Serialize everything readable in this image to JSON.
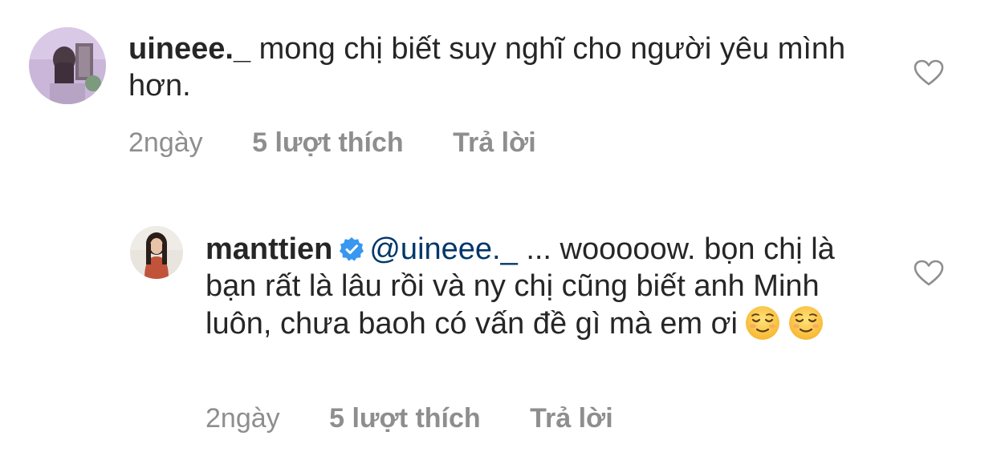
{
  "comments": [
    {
      "username": "uineee._",
      "text": "mong chị biết suy nghĩ cho người yêu mình hơn.",
      "time": "2ngày",
      "likes": "5 lượt thích",
      "reply": "Trả lời",
      "avatar_icon": "user-avatar-icon",
      "like_icon": "heart-outline-icon"
    },
    {
      "username": "manttien",
      "verified": true,
      "verified_icon": "verified-badge-icon",
      "mention": "@uineee._",
      "text": "... wooooow. bọn chị là bạn rất là lâu rồi và ny chị cũng biết anh Minh luôn, chưa baoh có vấn đề gì mà em ơi",
      "emojis": [
        "relieved-face-icon",
        "relieved-face-icon"
      ],
      "time": "2ngày",
      "likes": "5 lượt thích",
      "reply": "Trả lời",
      "avatar_icon": "user-avatar-icon",
      "like_icon": "heart-outline-icon"
    }
  ],
  "colors": {
    "text": "#262626",
    "meta": "#8e8e8e",
    "mention": "#00376b",
    "verified": "#3897f0"
  }
}
